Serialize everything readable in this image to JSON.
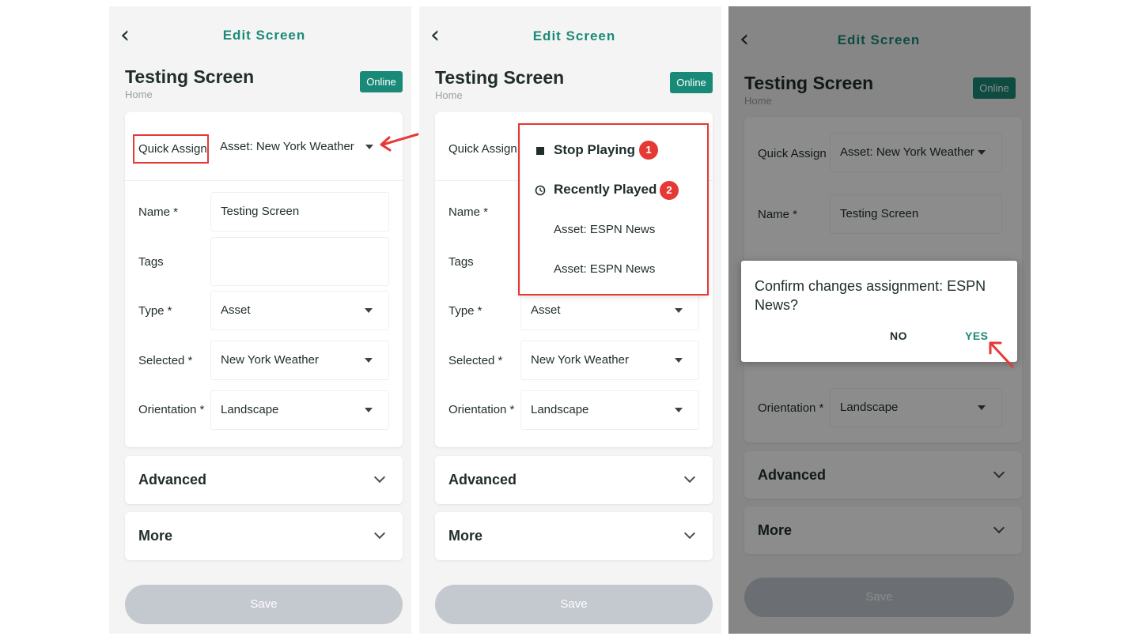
{
  "header": {
    "back_glyph": "‹",
    "title": "Edit Screen"
  },
  "screen": {
    "name": "Testing Screen",
    "location": "Home",
    "status": "Online"
  },
  "form": {
    "quick_assign_label": "Quick Assign",
    "quick_assign_value": "Asset: New York Weather",
    "name_label": "Name *",
    "name_value": "Testing Screen",
    "tags_label": "Tags",
    "tags_value": "",
    "type_label": "Type *",
    "type_value": "Asset",
    "selected_label": "Selected *",
    "selected_value": "New York Weather",
    "orientation_label": "Orientation *",
    "orientation_value": "Landscape"
  },
  "sections": {
    "advanced": "Advanced",
    "more": "More"
  },
  "save_label": "Save",
  "dropdown": {
    "stop_playing": "Stop Playing",
    "recently_played": "Recently Played",
    "items": [
      "Asset: ESPN News",
      "Asset: ESPN News"
    ],
    "badge_1": "1",
    "badge_2": "2"
  },
  "dialog": {
    "message": "Confirm changes assignment: ESPN News?",
    "no": "NO",
    "yes": "YES"
  },
  "colors": {
    "accent": "#1a8a78",
    "annotation": "#e53935",
    "save_disabled": "#c4c8cf"
  },
  "icons": {
    "back": "chevron-left-icon",
    "caret": "caret-down-icon",
    "stop": "stop-square-icon",
    "recent": "clock-icon",
    "expand": "chevron-down-icon"
  }
}
